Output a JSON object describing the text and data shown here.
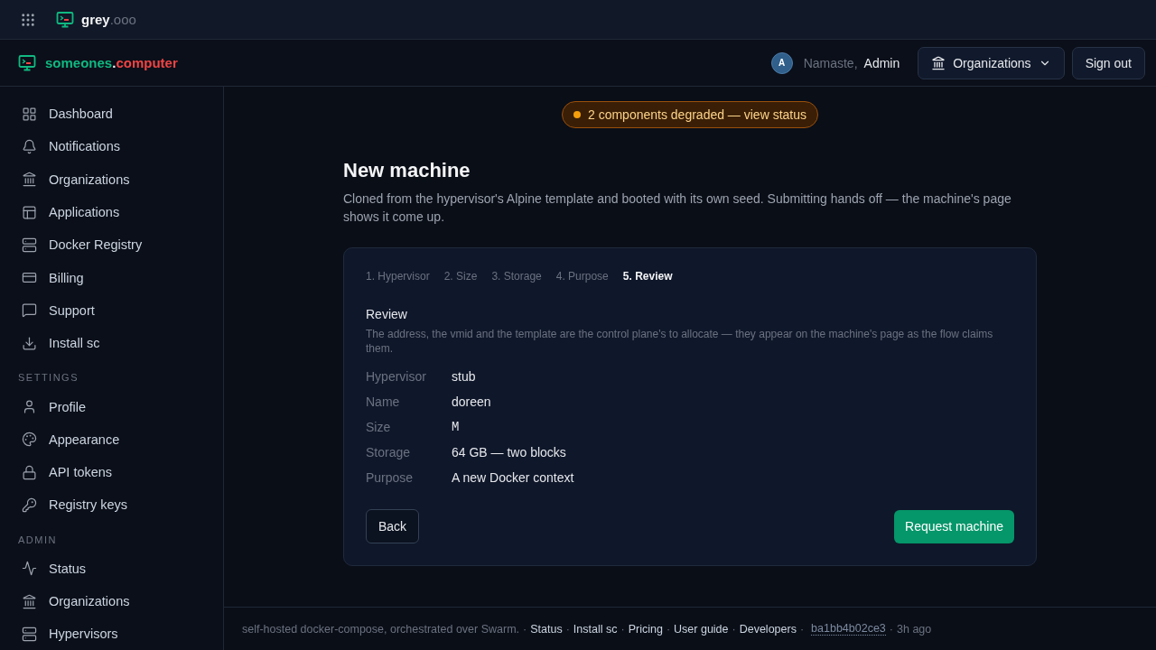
{
  "topbar": {
    "brand": "grey",
    "brand_suffix": ".ooo"
  },
  "header": {
    "logo_main": "someones",
    "logo_dot": ".",
    "logo_tld": "computer",
    "avatar": "A",
    "greeting": "Namaste,",
    "user": "Admin",
    "org_button": "Organizations",
    "sign_out": "Sign out"
  },
  "sidebar": {
    "sections": [
      {
        "items": [
          "Dashboard",
          "Notifications",
          "Organizations",
          "Applications",
          "Docker Registry",
          "Billing",
          "Support",
          "Install sc"
        ]
      },
      {
        "title": "SETTINGS",
        "items": [
          "Profile",
          "Appearance",
          "API tokens",
          "Registry keys"
        ]
      },
      {
        "title": "ADMIN",
        "items": [
          "Status",
          "Organizations",
          "Hypervisors"
        ]
      }
    ]
  },
  "status_badge": {
    "text": "2 components degraded — view status",
    "color": "#f59e0b"
  },
  "page": {
    "title": "New machine",
    "description": "Cloned from the hypervisor's Alpine template and booted with its own seed. Submitting hands off — the machine's page shows it come up."
  },
  "wizard": {
    "steps": [
      {
        "label": "1. Hypervisor",
        "selected": false
      },
      {
        "label": "2. Size",
        "selected": false
      },
      {
        "label": "3. Storage",
        "selected": false
      },
      {
        "label": "4. Purpose",
        "selected": false
      },
      {
        "label": "5. Review",
        "selected": true
      }
    ],
    "section_title": "Review",
    "section_note": "The address, the vmid and the template are the control plane's to allocate — they appear on the machine's page as the flow claims them.",
    "rows": [
      {
        "label": "Hypervisor",
        "value": "stub",
        "mono": false
      },
      {
        "label": "Name",
        "value": "doreen",
        "mono": false
      },
      {
        "label": "Size",
        "value": "M",
        "mono": true
      },
      {
        "label": "Storage",
        "value": "64 GB — two blocks",
        "mono": false
      },
      {
        "label": "Purpose",
        "value": "A new Docker context",
        "mono": false
      }
    ],
    "back": "Back",
    "submit": "Request machine"
  },
  "footer": {
    "items": [
      {
        "kind": "text",
        "text": "self-hosted docker-compose, orchestrated over Swarm."
      },
      {
        "kind": "sep",
        "text": "·"
      },
      {
        "kind": "link",
        "text": "Status"
      },
      {
        "kind": "sep",
        "text": "·"
      },
      {
        "kind": "link",
        "text": "Install sc"
      },
      {
        "kind": "sep",
        "text": "·"
      },
      {
        "kind": "link",
        "text": "Pricing"
      },
      {
        "kind": "sep",
        "text": "·"
      },
      {
        "kind": "link",
        "text": "User guide"
      },
      {
        "kind": "sep",
        "text": "·"
      },
      {
        "kind": "link",
        "text": "Developers"
      },
      {
        "kind": "sep",
        "text": "·"
      },
      {
        "kind": "hash",
        "text": "ba1bb4b02ce3"
      },
      {
        "kind": "sep",
        "text": "·"
      },
      {
        "kind": "text",
        "text": "3h ago"
      }
    ]
  }
}
